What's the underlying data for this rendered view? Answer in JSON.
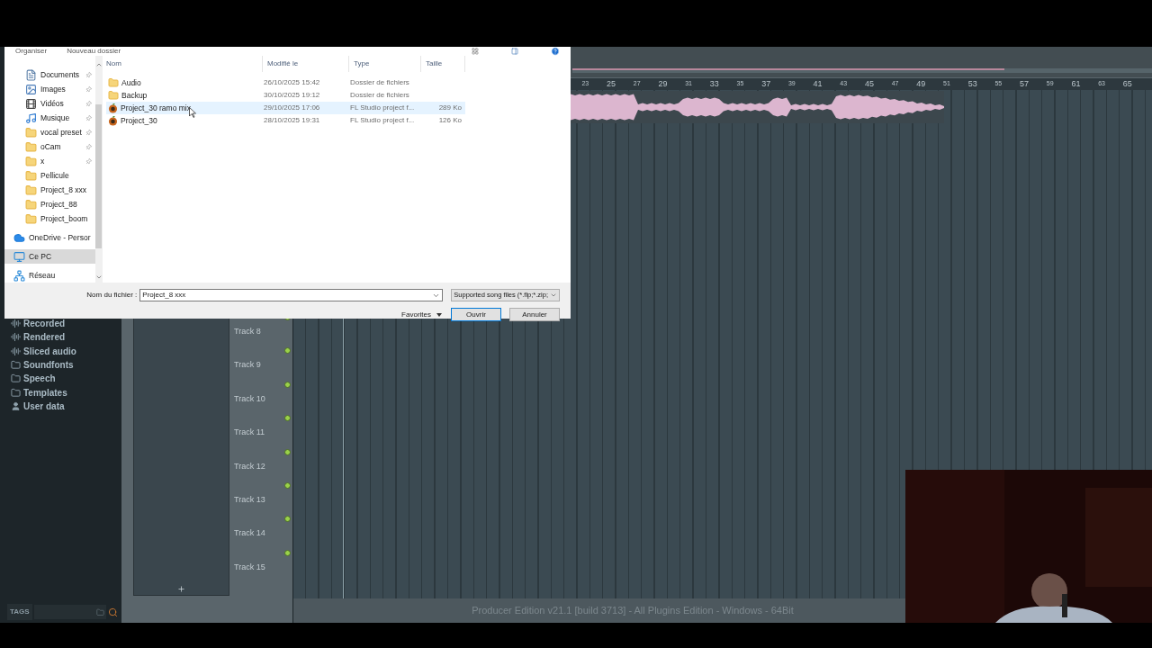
{
  "dialog": {
    "toolbar": [
      "Organiser",
      "Nouveau dossier"
    ],
    "nav_items": [
      {
        "label": "Documents",
        "kind": "documents",
        "pinned": true,
        "selected": false
      },
      {
        "label": "Images",
        "kind": "images",
        "pinned": true,
        "selected": false
      },
      {
        "label": "Vidéos",
        "kind": "videos",
        "pinned": true,
        "selected": false
      },
      {
        "label": "Musique",
        "kind": "music",
        "pinned": true,
        "selected": false
      },
      {
        "label": "vocal preset",
        "kind": "folder",
        "pinned": true,
        "selected": false
      },
      {
        "label": "oCam",
        "kind": "folder",
        "pinned": true,
        "selected": false
      },
      {
        "label": "x",
        "kind": "folder",
        "pinned": true,
        "selected": false
      },
      {
        "label": "Pellicule",
        "kind": "folder",
        "pinned": false,
        "selected": false
      },
      {
        "label": "Project_8 xxx",
        "kind": "folder",
        "pinned": false,
        "selected": false
      },
      {
        "label": "Project_88",
        "kind": "folder",
        "pinned": false,
        "selected": false
      },
      {
        "label": "Project_boom",
        "kind": "folder",
        "pinned": false,
        "selected": false
      },
      {
        "label": "OneDrive - Persor",
        "kind": "cloud",
        "pinned": false,
        "selected": false
      },
      {
        "label": "Ce PC",
        "kind": "pc",
        "pinned": false,
        "selected": true
      },
      {
        "label": "Réseau",
        "kind": "network",
        "pinned": false,
        "selected": false
      }
    ],
    "columns": [
      "Nom",
      "Modifié le",
      "Type",
      "Taille"
    ],
    "files": [
      {
        "name": "Audio",
        "kind": "folder",
        "modified": "26/10/2025 15:42",
        "type": "Dossier de fichiers",
        "selected": false
      },
      {
        "name": "Backup",
        "kind": "folder",
        "modified": "30/10/2025 19:12",
        "type": "Dossier de fichiers",
        "selected": false
      },
      {
        "name": "Project_30 ramo mix",
        "kind": "project",
        "modified": "29/10/2025 17:06",
        "type": "FL Studio project f...",
        "size": "289 Ko",
        "selected": true
      },
      {
        "name": "Project_30",
        "kind": "project",
        "modified": "28/10/2025 19:31",
        "type": "FL Studio project f...",
        "size": "126 Ko",
        "selected": false
      }
    ],
    "filename_label": "Nom du fichier :",
    "filename": "Project_8 xxx",
    "filter": "Supported song files (*.flp;*.zip;",
    "favorites": "Favorites",
    "open_button": "Ouvrir",
    "cancel_button": "Annuler"
  },
  "browser": {
    "items": [
      {
        "label": "Recorded",
        "kind": "audio"
      },
      {
        "label": "Rendered",
        "kind": "audio"
      },
      {
        "label": "Sliced audio",
        "kind": "audio"
      },
      {
        "label": "Soundfonts",
        "kind": "folder"
      },
      {
        "label": "Speech",
        "kind": "folder"
      },
      {
        "label": "Templates",
        "kind": "folder"
      },
      {
        "label": "User data",
        "kind": "user"
      }
    ],
    "tags": "TAGS"
  },
  "playlist": {
    "ruler": [
      "23",
      "25",
      "27",
      "29",
      "31",
      "33",
      "35",
      "37",
      "39",
      "41",
      "43",
      "45",
      "47",
      "49",
      "51",
      "53",
      "55",
      "57",
      "59",
      "61",
      "63",
      "65"
    ],
    "tracks": [
      "Track 8",
      "Track 9",
      "Track 10",
      "Track 11",
      "Track 12",
      "Track 13",
      "Track 14",
      "Track 15"
    ]
  },
  "status_bar": "Producer Edition v21.1 [build 3713] - All Plugins Edition - Windows - 64Bit"
}
